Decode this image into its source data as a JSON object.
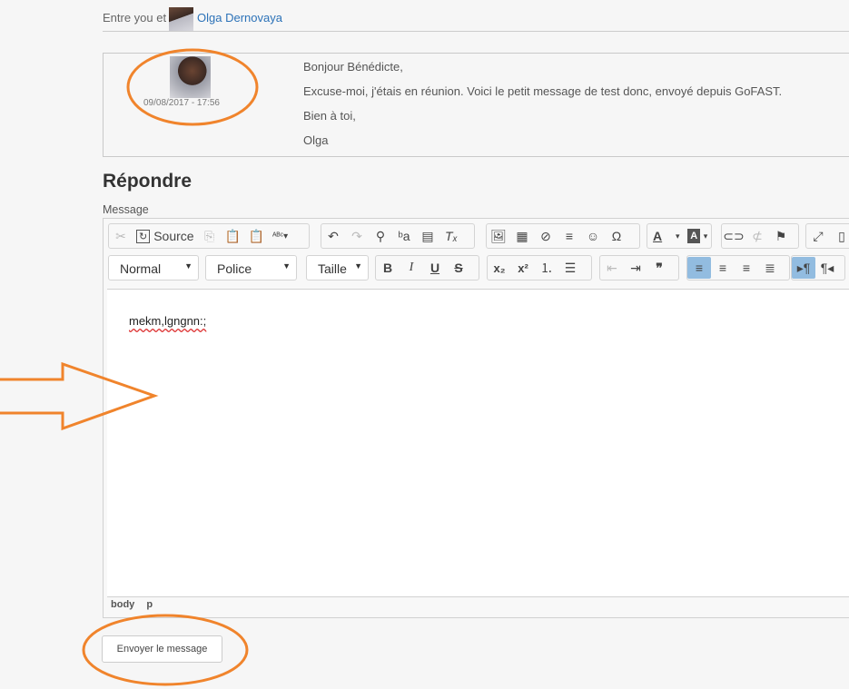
{
  "header": {
    "label": "Entre you et",
    "author": "Olga Dernovaya"
  },
  "message": {
    "date": "09/08/2017 - 17:56",
    "lines": [
      "Bonjour Bénédicte,",
      "Excuse-moi, j'étais en réunion. Voici le petit message de test donc, envoyé depuis GoFAST.",
      "Bien à toi,",
      "Olga"
    ]
  },
  "reply": {
    "title": "Répondre",
    "label": "Message"
  },
  "toolbar": {
    "source_label": "Source",
    "format_combo": "Normal",
    "font_combo": "Police",
    "size_combo": "Taille",
    "bold": "B",
    "italic": "I",
    "underline": "U",
    "strike": "S",
    "subscript": "x₂",
    "superscript": "x²",
    "quote": "❞",
    "special_char": "Ω",
    "text_color": "A",
    "bg_color": "A",
    "icons": [
      "cut-icon",
      "source-icon",
      "copy-icon",
      "paste-icon",
      "paste-text-icon",
      "spellcheck-icon",
      "undo-icon",
      "redo-icon",
      "find-icon",
      "replace-icon",
      "select-all-icon",
      "remove-format-icon",
      "image-icon",
      "table-icon",
      "flash-icon",
      "horizontal-rule-icon",
      "smiley-icon",
      "omega-icon",
      "link-icon",
      "unlink-icon",
      "anchor-icon",
      "maximize-icon",
      "show-blocks-icon",
      "numbered-list-icon",
      "bullet-list-icon",
      "outdent-icon",
      "indent-icon",
      "align-left-icon",
      "align-center-icon",
      "align-right-icon",
      "justify-icon",
      "ltr-icon",
      "rtl-icon"
    ]
  },
  "editor": {
    "content": "mekm,lgngnn:;",
    "path": [
      "body",
      "p"
    ]
  },
  "submit": {
    "label": "Envoyer le message"
  },
  "colors": {
    "annotation": "#f0842c",
    "link": "#2c72b8",
    "active_button": "#92bce0"
  }
}
